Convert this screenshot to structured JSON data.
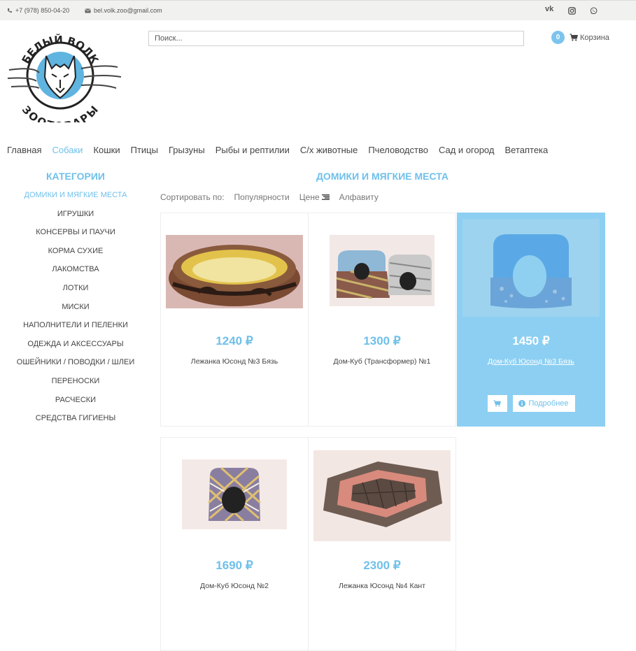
{
  "topbar": {
    "phone": "+7 (978) 850-04-20",
    "email": "bel.volk.zoo@gmail.com",
    "social": [
      "vk-icon",
      "instagram-icon",
      "whatsapp-icon"
    ]
  },
  "logo": {
    "top_text": "БЕЛЫЙ ВОЛК",
    "bottom_text": "ЗООТОВАРЫ"
  },
  "search": {
    "placeholder": "Поиск..."
  },
  "cart": {
    "count": "0",
    "label": "Корзина"
  },
  "nav": [
    {
      "label": "Главная",
      "active": false
    },
    {
      "label": "Собаки",
      "active": true
    },
    {
      "label": "Кошки",
      "active": false
    },
    {
      "label": "Птицы",
      "active": false
    },
    {
      "label": "Грызуны",
      "active": false
    },
    {
      "label": "Рыбы и рептилии",
      "active": false
    },
    {
      "label": "С/х животные",
      "active": false
    },
    {
      "label": "Пчеловодство",
      "active": false
    },
    {
      "label": "Сад и огород",
      "active": false
    },
    {
      "label": "Ветаптека",
      "active": false
    }
  ],
  "categories": {
    "title": "КАТЕГОРИИ",
    "items": [
      {
        "label": "ДОМИКИ И МЯГКИЕ МЕСТА",
        "active": true
      },
      {
        "label": "ИГРУШКИ",
        "active": false
      },
      {
        "label": "КОНСЕРВЫ И ПАУЧИ",
        "active": false
      },
      {
        "label": "КОРМА СУХИЕ",
        "active": false
      },
      {
        "label": "ЛАКОМСТВА",
        "active": false
      },
      {
        "label": "ЛОТКИ",
        "active": false
      },
      {
        "label": "МИСКИ",
        "active": false
      },
      {
        "label": "НАПОЛНИТЕЛИ И ПЕЛЕНКИ",
        "active": false
      },
      {
        "label": "ОДЕЖДА И АКСЕССУАРЫ",
        "active": false
      },
      {
        "label": "ОШЕЙНИКИ / ПОВОДКИ / ШЛЕИ",
        "active": false
      },
      {
        "label": "ПЕРЕНОСКИ",
        "active": false
      },
      {
        "label": "РАСЧЕСКИ",
        "active": false
      },
      {
        "label": "СРЕДСТВА ГИГИЕНЫ",
        "active": false
      }
    ]
  },
  "section": {
    "title": "ДОМИКИ И МЯГКИЕ МЕСТА"
  },
  "sort": {
    "label": "Сортировать по:",
    "options": [
      "Популярности",
      "Цене",
      "Алфавиту"
    ]
  },
  "products": [
    {
      "price": "1240 ₽",
      "name": "Лежанка Юсонд №3 Бязь",
      "image": "round-pet-bed"
    },
    {
      "price": "1300 ₽",
      "name": "Дом-Куб (Трансформер) №1",
      "image": "pet-house-pair"
    },
    {
      "price": "1450 ₽",
      "name": "Дом-Куб Юсонд №3 Бязь",
      "image": "blue-pet-house",
      "hover": true
    },
    {
      "price": "1690 ₽",
      "name": "Дом-Куб Юсонд №2",
      "image": "plaid-cube-house"
    },
    {
      "price": "2300 ₽",
      "name": "Лежанка Юсонд №4 Кант",
      "image": "square-pet-bed"
    }
  ],
  "buttons": {
    "details": "Подробнее"
  },
  "colors": {
    "accent": "#6fc0ea",
    "hover_card": "#8ccff2"
  }
}
